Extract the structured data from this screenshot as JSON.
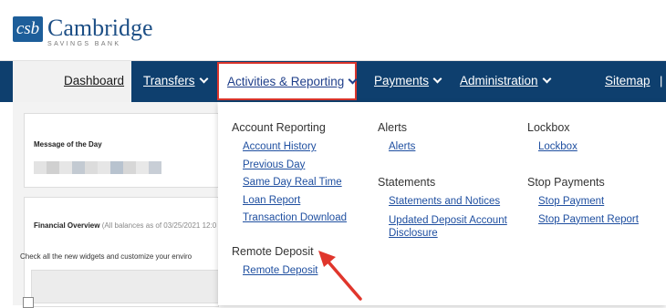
{
  "brand": {
    "mark": "csb",
    "name": "Cambridge",
    "tagline": "SAVINGS BANK"
  },
  "nav": {
    "items": [
      "Dashboard",
      "Transfers",
      "Activities & Reporting",
      "Payments",
      "Administration",
      "Sitemap"
    ],
    "separator": "|"
  },
  "colors": {
    "nav_bg": "#0e3f6e",
    "brand": "#1d5e9a",
    "highlight": "#d9342b",
    "link": "#1f4fa0"
  },
  "content": {
    "motd_title": "Message of the Day",
    "fin_title": "Financial Overview",
    "fin_note": "(All balances as of 03/25/2021 12:0",
    "check_text": "Check all the new widgets and customize your enviro"
  },
  "menu": {
    "account_reporting": {
      "title": "Account Reporting",
      "links": [
        "Account History",
        "Previous Day",
        "Same Day Real Time",
        "Loan Report",
        "Transaction Download"
      ]
    },
    "remote_deposit": {
      "title": "Remote Deposit",
      "links": [
        "Remote Deposit"
      ]
    },
    "alerts": {
      "title": "Alerts",
      "links": [
        "Alerts"
      ]
    },
    "statements": {
      "title": "Statements",
      "links": [
        "Statements and Notices",
        "Updated Deposit Account Disclosure"
      ]
    },
    "lockbox": {
      "title": "Lockbox",
      "links": [
        "Lockbox"
      ]
    },
    "stop_payments": {
      "title": "Stop Payments",
      "links": [
        "Stop Payment",
        "Stop Payment Report"
      ]
    }
  }
}
